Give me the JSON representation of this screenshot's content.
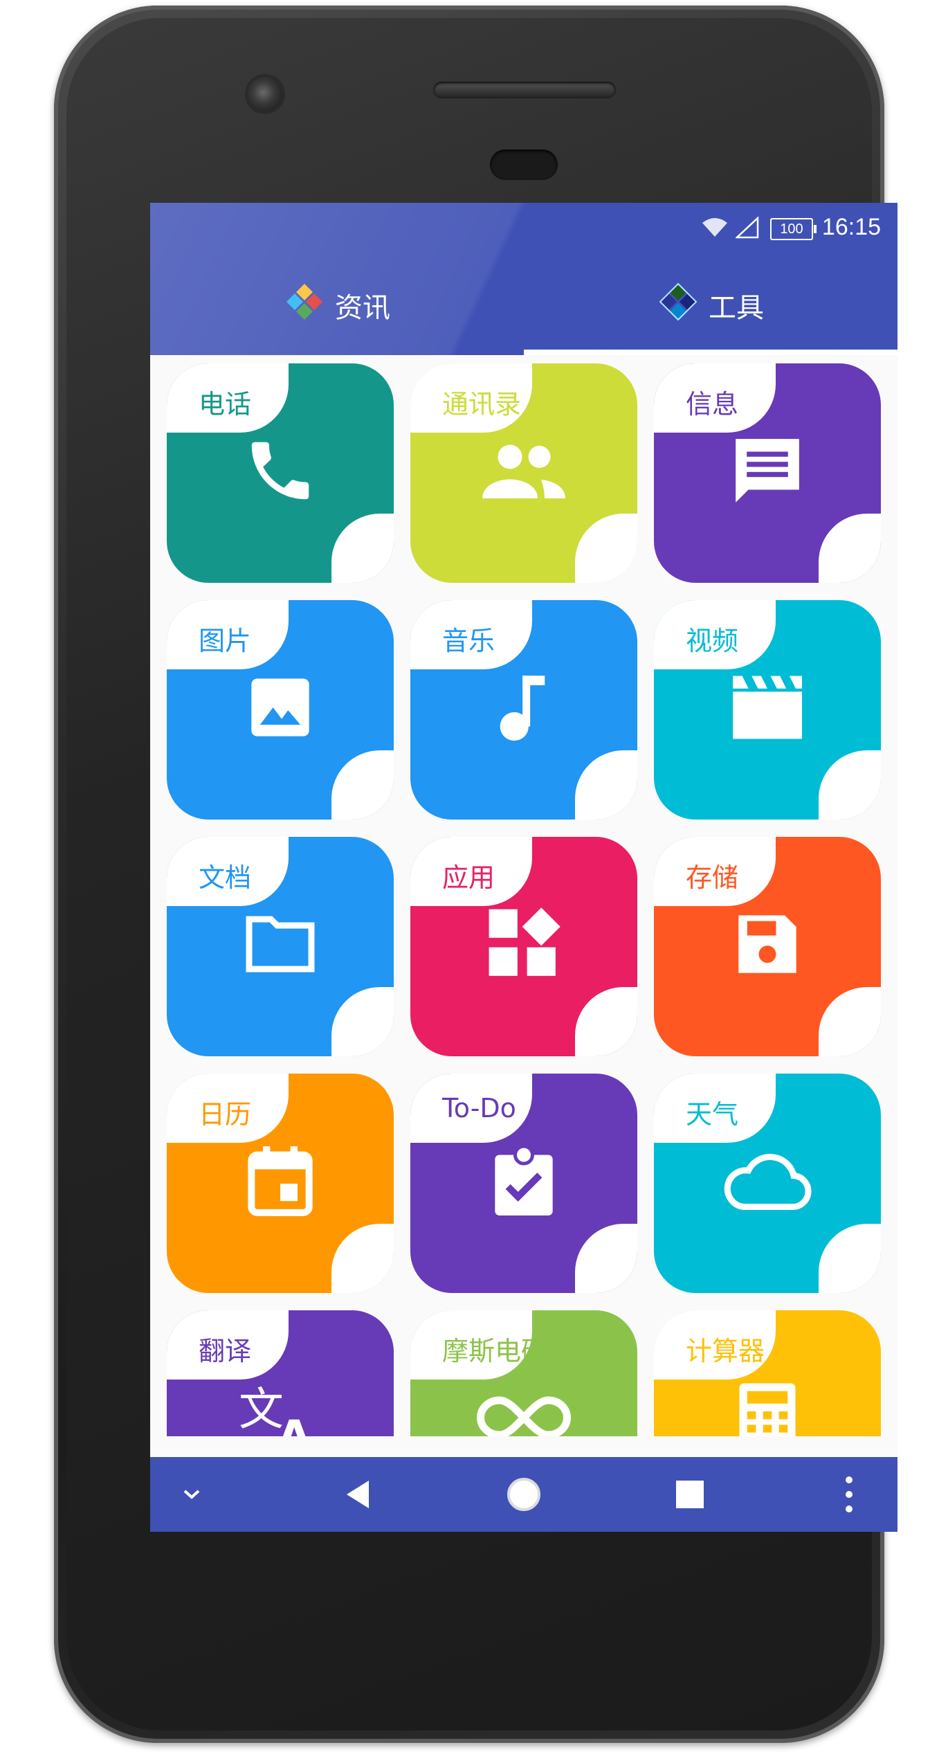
{
  "status": {
    "time": "16:15",
    "battery": "100"
  },
  "tabs": [
    {
      "label": "资讯"
    },
    {
      "label": "工具"
    }
  ],
  "selected_tab": "工具",
  "tiles": [
    {
      "label": "电话",
      "color": "#14978a",
      "icon": "phone-icon"
    },
    {
      "label": "通讯录",
      "color": "#cddc39",
      "icon": "contacts-icon"
    },
    {
      "label": "信息",
      "color": "#673ab7",
      "icon": "message-icon"
    },
    {
      "label": "图片",
      "color": "#2196f3",
      "icon": "image-icon"
    },
    {
      "label": "音乐",
      "color": "#2196f3",
      "icon": "music-note-icon"
    },
    {
      "label": "视频",
      "color": "#00bcd4",
      "icon": "movie-clapper-icon"
    },
    {
      "label": "文档",
      "color": "#2196f3",
      "icon": "folder-icon"
    },
    {
      "label": "应用",
      "color": "#e91e63",
      "icon": "apps-widgets-icon"
    },
    {
      "label": "存储",
      "color": "#ff5722",
      "icon": "floppy-disk-icon"
    },
    {
      "label": "日历",
      "color": "#ff9800",
      "icon": "calendar-icon"
    },
    {
      "label": "To-Do",
      "color": "#673ab7",
      "icon": "clipboard-check-icon"
    },
    {
      "label": "天气",
      "color": "#00bcd4",
      "icon": "cloud-icon"
    },
    {
      "label": "翻译",
      "color": "#673ab7",
      "icon": "translate-icon"
    },
    {
      "label": "摩斯电码",
      "color": "#8bc34a",
      "icon": "infinity-icon"
    },
    {
      "label": "计算器",
      "color": "#ffc107",
      "icon": "calculator-icon"
    }
  ],
  "colors": {
    "primary": "#3f51b5",
    "background": "#fafafa"
  },
  "navigation": [
    "chevron-down-icon",
    "back-icon",
    "home-icon",
    "recents-icon",
    "more-vert-icon"
  ]
}
